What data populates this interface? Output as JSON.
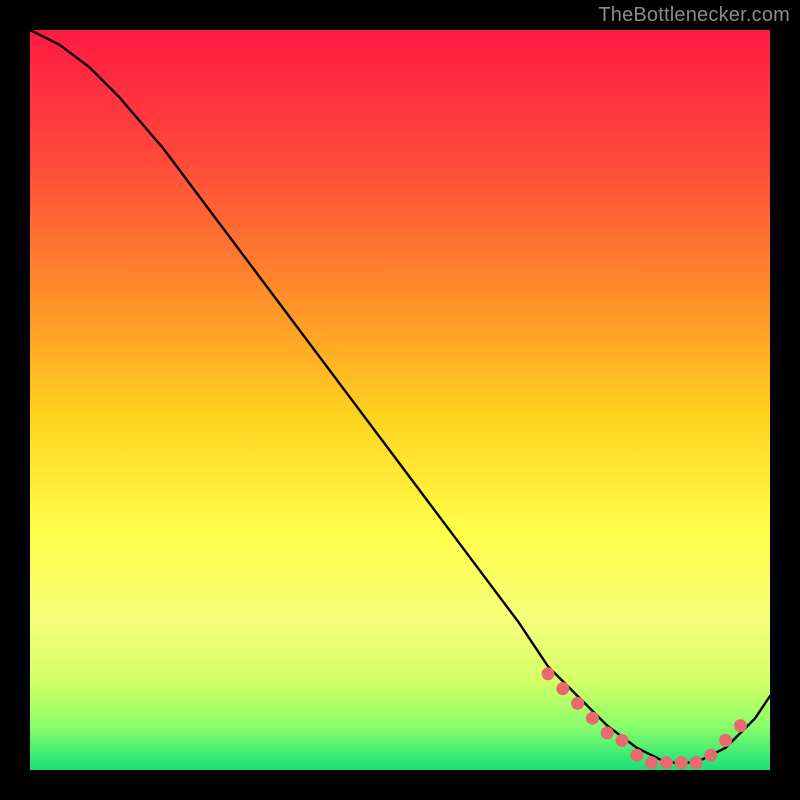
{
  "attribution": "TheBottlenecker.com",
  "colors": {
    "background": "#000000",
    "line": "#000000",
    "marker": "#e86a6f",
    "gradient_top": "#ff1a44",
    "gradient_mid1": "#ff7a2a",
    "gradient_mid2": "#ffd21f",
    "gradient_mid3": "#ffff4a",
    "gradient_mid4": "#d4ff66",
    "gradient_bottom": "#18e07a"
  },
  "chart_data": {
    "type": "line",
    "title": "",
    "xlabel": "",
    "ylabel": "",
    "xlim": [
      0,
      100
    ],
    "ylim": [
      0,
      100
    ],
    "series": [
      {
        "name": "bottleneck-curve",
        "x": [
          0,
          4,
          8,
          12,
          18,
          24,
          30,
          36,
          42,
          48,
          54,
          60,
          66,
          70,
          74,
          78,
          82,
          86,
          90,
          94,
          98,
          100
        ],
        "y": [
          100,
          98,
          95,
          91,
          84,
          76,
          68,
          60,
          52,
          44,
          36,
          28,
          20,
          14,
          10,
          6,
          3,
          1,
          1,
          3,
          7,
          10
        ]
      }
    ],
    "markers": {
      "name": "highlighted-range",
      "x": [
        70,
        72,
        74,
        76,
        78,
        80,
        82,
        84,
        86,
        88,
        90,
        92,
        94,
        96
      ],
      "y": [
        13,
        11,
        9,
        7,
        5,
        4,
        2,
        1,
        1,
        1,
        1,
        2,
        4,
        6
      ]
    }
  }
}
